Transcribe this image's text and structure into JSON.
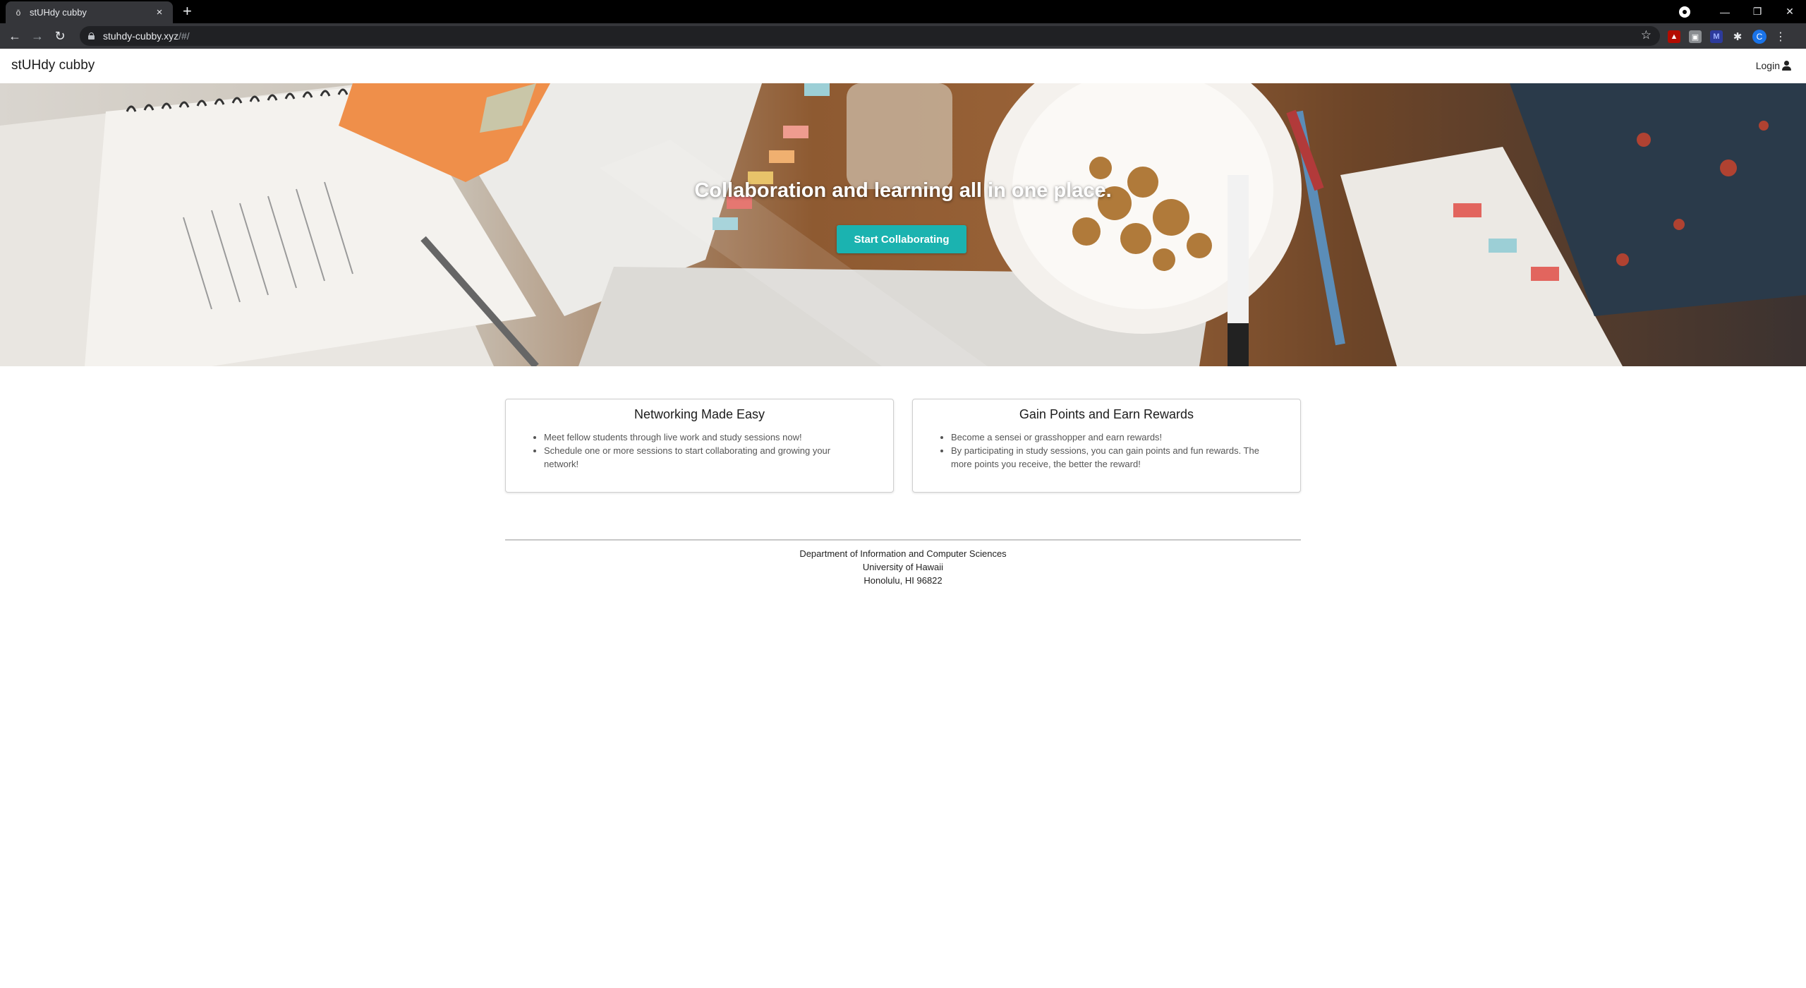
{
  "browser": {
    "tab_title": "stUHdy cubby",
    "new_tab": "+",
    "close": "×",
    "url_host": "stuhdy-cubby.xyz",
    "url_path": "/#/",
    "profile_initial": "C",
    "window_controls": [
      "—",
      "❐",
      "✕"
    ]
  },
  "navbar": {
    "brand": "stUHdy cubby",
    "login_label": "Login"
  },
  "hero": {
    "headline": "Collaboration and learning all in one place.",
    "cta_label": "Start Collaborating",
    "accent_color": "#1bb3b0"
  },
  "cards": [
    {
      "title": "Networking Made Easy",
      "items": [
        "Meet fellow students through live work and study sessions now!",
        "Schedule one or more sessions to start collaborating and growing your network!"
      ]
    },
    {
      "title": "Gain Points and Earn Rewards",
      "items": [
        "Become a sensei or grasshopper and earn rewards!",
        "By participating in study sessions, you can gain points and fun rewards. The more points you receive, the better the reward!"
      ]
    }
  ],
  "footer": {
    "line1": "Department of Information and Computer Sciences",
    "line2": "University of Hawaii",
    "line3": "Honolulu, HI 96822"
  },
  "icons": [
    "favicon-icon",
    "back-icon",
    "forward-icon",
    "reload-icon",
    "lock-icon",
    "star-icon",
    "user-icon"
  ]
}
